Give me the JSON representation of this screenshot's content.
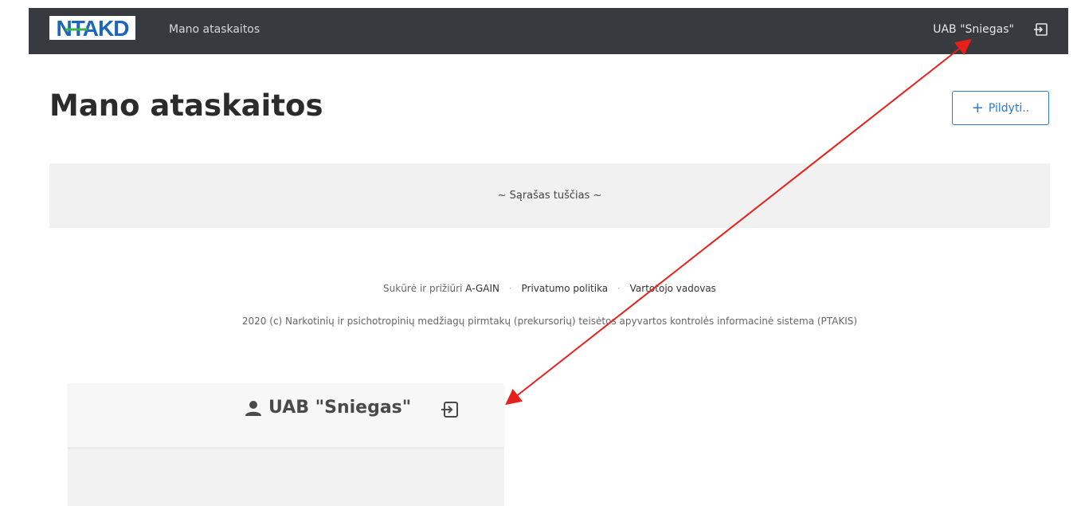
{
  "navbar": {
    "logo_text": "NTAKD",
    "link_label": "Mano ataskaitos",
    "user_label": "UAB \"Sniegas\""
  },
  "main": {
    "title": "Mano ataskaitos",
    "fill_button_label": "Pildyti..",
    "empty_message": "~ Sąrašas tuščias ~"
  },
  "footer": {
    "created_prefix": "Sukūrė ir prižiūri",
    "created_by": "A-GAIN",
    "privacy_link": "Privatumo politika",
    "manual_link": "Vartotojo vadovas",
    "copyright": "2020 (c) Narkotinių ir psichotropinių medžiagų pirmtakų (prekursorių) teisėtos apyvartos kontrolės informacinė sistema (PTAKIS)"
  },
  "zoom": {
    "user_label": "UAB \"Sniegas\""
  },
  "colors": {
    "navbar_bg": "#373a3f",
    "accent": "#2a7bd1",
    "arrow": "#e8201a"
  }
}
